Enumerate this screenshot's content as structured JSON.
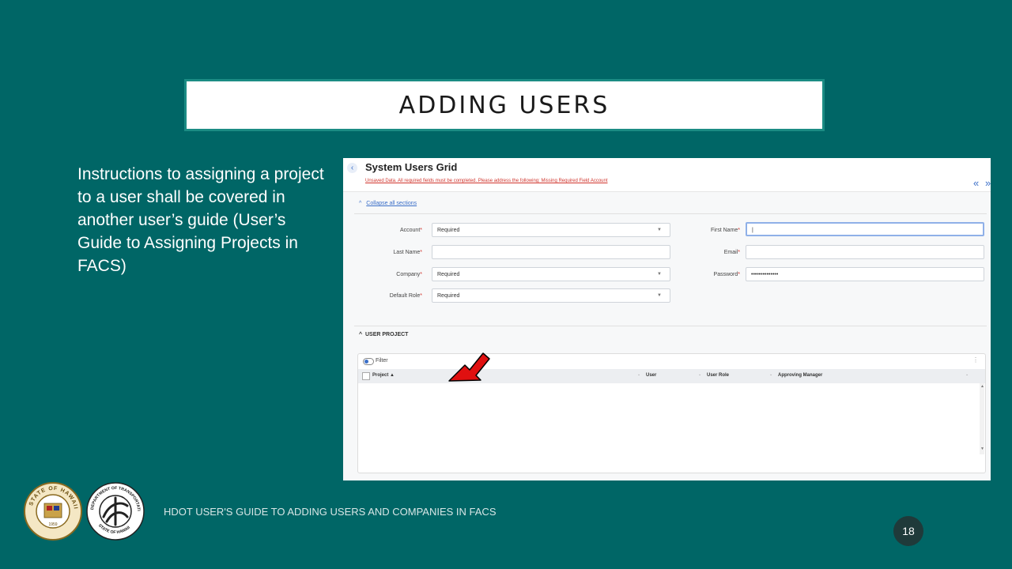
{
  "slide": {
    "title": "ADDING USERS",
    "instructions": "Instructions to assigning a project to a user shall be covered in another user’s guide (User’s Guide to Assigning Projects in FACS)",
    "footer": "HDOT USER'S GUIDE TO ADDING USERS AND COMPANIES IN FACS",
    "page_number": "18",
    "seal_left": {
      "ring_text": "STATE OF HAWAII",
      "year": "1959"
    },
    "seal_right": {
      "ring_text_top": "DEPARTMENT OF TRANSPORTATION",
      "ring_text_bottom": "STATE OF HAWAII"
    },
    "colors": {
      "background": "#006666",
      "title_border": "#1b8c84",
      "arrow": "#e01010"
    }
  },
  "screenshot": {
    "header": {
      "back_icon": "chevron-left-icon",
      "title": "System Users Grid",
      "warning": "Unsaved Data. All required fields must be completed. Please address the following: Missing Required Field Account",
      "nav_prev": "«",
      "nav_next": "»"
    },
    "collapse_label": "Collapse all sections",
    "collapse_icon": "^",
    "form": {
      "required_marker": "*",
      "account": {
        "label": "Account",
        "value": "Required"
      },
      "last_name": {
        "label": "Last Name",
        "value": ""
      },
      "company": {
        "label": "Company",
        "value": "Required"
      },
      "default_role": {
        "label": "Default Role",
        "value": "Required"
      },
      "first_name": {
        "label": "First Name",
        "value": "|"
      },
      "email": {
        "label": "Email",
        "value": ""
      },
      "password": {
        "label": "Password",
        "value": "••••••••••••••"
      }
    },
    "user_project": {
      "section_label": "USER PROJECT",
      "filter_label": "Filter",
      "columns": [
        "Project ▲",
        "User",
        "User Role",
        "Approving Manager"
      ],
      "rows": []
    }
  }
}
